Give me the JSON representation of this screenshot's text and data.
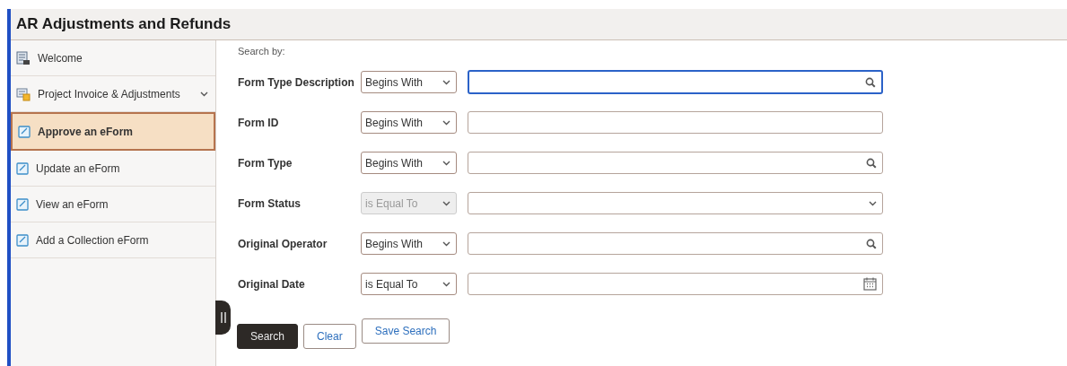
{
  "window": {
    "title": "AR Adjustments and Refunds"
  },
  "sidebar": {
    "items": [
      {
        "label": "Welcome",
        "selected": false,
        "expandable": false
      },
      {
        "label": "Project Invoice & Adjustments",
        "selected": false,
        "expandable": true
      },
      {
        "label": "Approve an eForm",
        "selected": true,
        "expandable": false
      },
      {
        "label": "Update an eForm",
        "selected": false,
        "expandable": false
      },
      {
        "label": "View an eForm",
        "selected": false,
        "expandable": false
      },
      {
        "label": "Add a Collection eForm",
        "selected": false,
        "expandable": false
      }
    ]
  },
  "search": {
    "heading": "Search by:",
    "fields": [
      {
        "label": "Form Type Description",
        "operator": "Begins With",
        "operator_disabled": false,
        "kind": "lookup",
        "focused": true
      },
      {
        "label": "Form ID",
        "operator": "Begins With",
        "operator_disabled": false,
        "kind": "text",
        "focused": false
      },
      {
        "label": "Form Type",
        "operator": "Begins With",
        "operator_disabled": false,
        "kind": "lookup",
        "focused": false
      },
      {
        "label": "Form Status",
        "operator": "is Equal To",
        "operator_disabled": true,
        "kind": "dropdown",
        "focused": false
      },
      {
        "label": "Original Operator",
        "operator": "Begins With",
        "operator_disabled": false,
        "kind": "lookup",
        "focused": false
      },
      {
        "label": "Original Date",
        "operator": "is Equal To",
        "operator_disabled": false,
        "kind": "date",
        "focused": false
      }
    ],
    "buttons": [
      {
        "label": "Search",
        "kind": "primary"
      },
      {
        "label": "Clear",
        "kind": "secondary"
      },
      {
        "label": "Save Search",
        "kind": "secondary"
      }
    ]
  }
}
